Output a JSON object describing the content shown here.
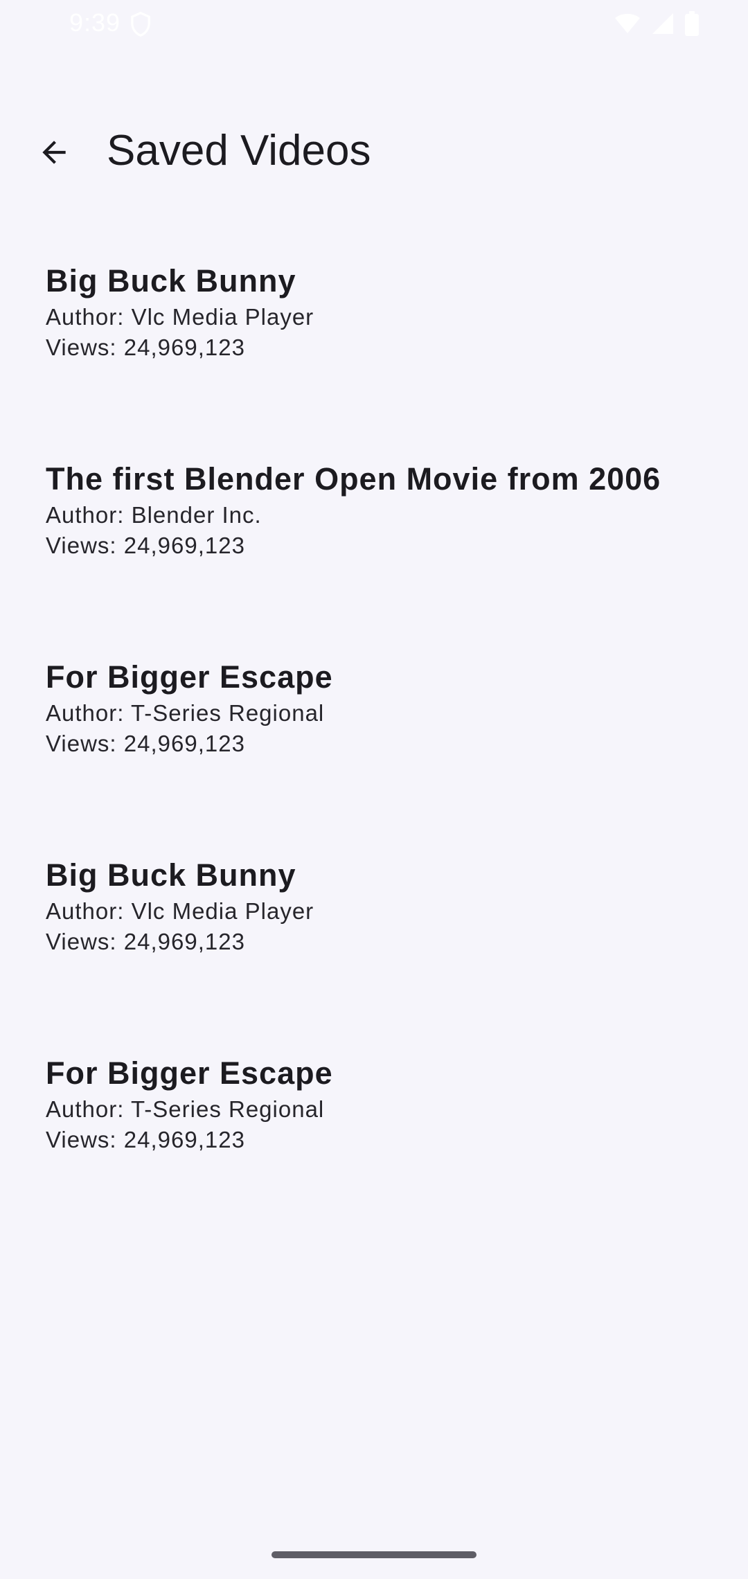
{
  "status_bar": {
    "time": "9:39"
  },
  "header": {
    "title": "Saved Videos",
    "back_icon": "arrow-back-icon"
  },
  "videos": [
    {
      "title": "Big Buck Bunny",
      "author": "Author: Vlc Media Player",
      "views": "Views: 24,969,123"
    },
    {
      "title": "The first Blender Open Movie from 2006",
      "author": "Author: Blender Inc.",
      "views": "Views: 24,969,123"
    },
    {
      "title": "For Bigger Escape",
      "author": "Author: T-Series Regional",
      "views": "Views: 24,969,123"
    },
    {
      "title": "Big Buck Bunny",
      "author": "Author: Vlc Media Player",
      "views": "Views: 24,969,123"
    },
    {
      "title": "For Bigger Escape",
      "author": "Author: T-Series Regional",
      "views": "Views: 24,969,123"
    }
  ],
  "colors": {
    "background": "#f6f5fb",
    "text": "#1c1b20",
    "home_indicator": "#5f5e66"
  }
}
